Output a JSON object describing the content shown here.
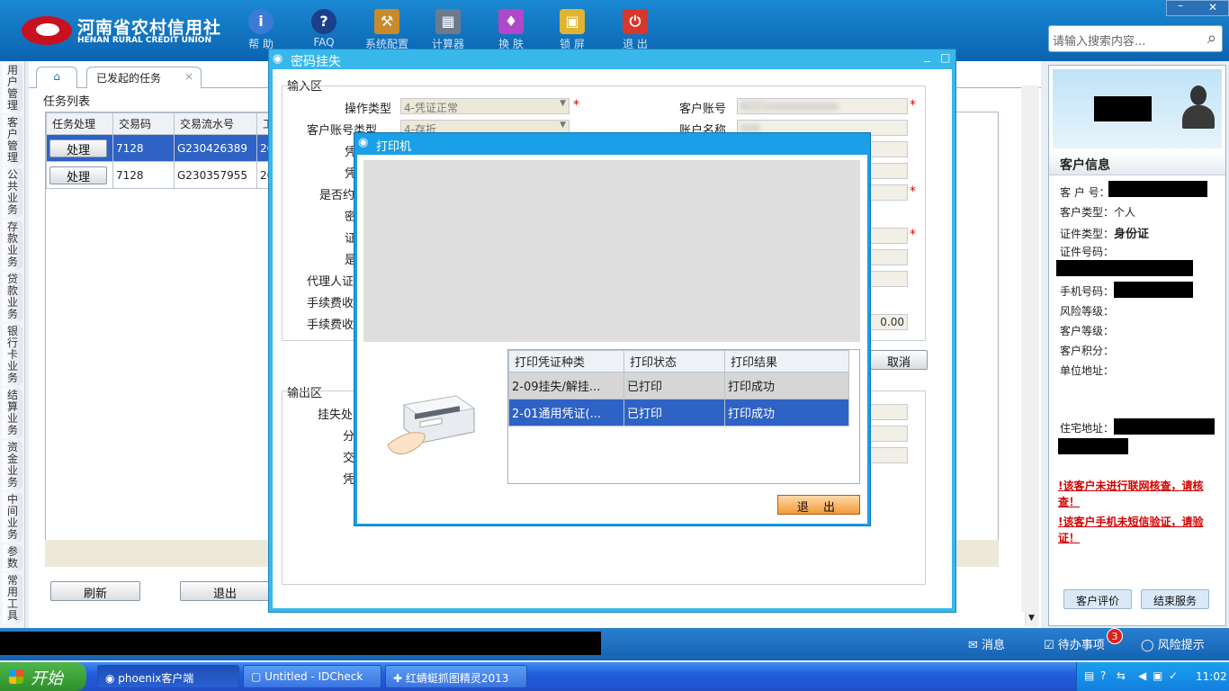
{
  "header": {
    "brand_cn": "河南省农村信用社",
    "brand_en": "HENAN RURAL CREDIT UNION",
    "toolbar": [
      "帮 助",
      "FAQ",
      "系统配置",
      "计算器",
      "换 肤",
      "锁 屏",
      "退 出"
    ],
    "search_placeholder": "请输入搜索内容..."
  },
  "left_nav": [
    "用户管理",
    "客户管理",
    "公共业务",
    "存款业务",
    "贷款业务",
    "银行卡业务",
    "结算业务",
    "资金业务",
    "中间业务",
    "参数",
    "常用工具"
  ],
  "main": {
    "tab_label": "已发起的任务",
    "tab_close": "×",
    "task_list_label": "任务列表",
    "columns": [
      "任务处理",
      "交易码",
      "交易流水号",
      "工"
    ],
    "rows": [
      {
        "action": "处理",
        "code": "7128",
        "serial": "G230426389",
        "extra": "20"
      },
      {
        "action": "处理",
        "code": "7128",
        "serial": "G230357955",
        "extra": "20"
      }
    ],
    "refresh": "刷新",
    "exit": "退出"
  },
  "dialog_pwd": {
    "title": "密码挂失",
    "input_area": "输入区",
    "output_area": "输出区",
    "fields_left": [
      "操作类型",
      "客户账号类型",
      "凭",
      "凭",
      "是否约",
      "密",
      "证",
      "是",
      "代理人证",
      "手续费收",
      "手续费收"
    ],
    "op_type_value": "4-凭证正常",
    "acct_type_value": "4-存折",
    "fields_right": [
      "客户账号",
      "账户名称"
    ],
    "fee_value": "0.00",
    "cancel": "取消",
    "output_fields": [
      "挂失处",
      "分",
      "交",
      "凭"
    ]
  },
  "dialog_printer": {
    "title": "打印机",
    "columns": [
      "打印凭证种类",
      "打印状态",
      "打印结果"
    ],
    "rows": [
      {
        "kind": "2-09挂失/解挂...",
        "status": "已打印",
        "result": "打印成功"
      },
      {
        "kind": "2-01通用凭证(...",
        "status": "已打印",
        "result": "打印成功"
      }
    ],
    "exit": "退  出"
  },
  "customer": {
    "title": "客户信息",
    "fields": [
      {
        "label": "客 户 号：",
        "value": ""
      },
      {
        "label": "客户类型：",
        "value": "个人"
      },
      {
        "label": "证件类型：",
        "value": "身份证"
      },
      {
        "label": "证件号码：",
        "value": ""
      },
      {
        "label": "手机号码：",
        "value": ""
      },
      {
        "label": "风险等级：",
        "value": ""
      },
      {
        "label": "客户等级：",
        "value": ""
      },
      {
        "label": "客户积分：",
        "value": ""
      },
      {
        "label": "单位地址：",
        "value": ""
      },
      {
        "label": "住宅地址：",
        "value": ""
      }
    ],
    "warn1": "!该客户未进行联网核查，请核查！",
    "warn2": "!该客户手机未短信验证，请验证！",
    "evaluate": "客户评价",
    "end_service": "结束服务"
  },
  "statusbar": {
    "message": "消息",
    "todo": "待办事项",
    "todo_count": "3",
    "risk": "风险提示"
  },
  "taskbar": {
    "start": "开始",
    "tasks": [
      "phoenix客户端",
      "Untitled - IDCheck",
      "红蜻蜓抓图精灵2013"
    ],
    "time": "11:02"
  }
}
